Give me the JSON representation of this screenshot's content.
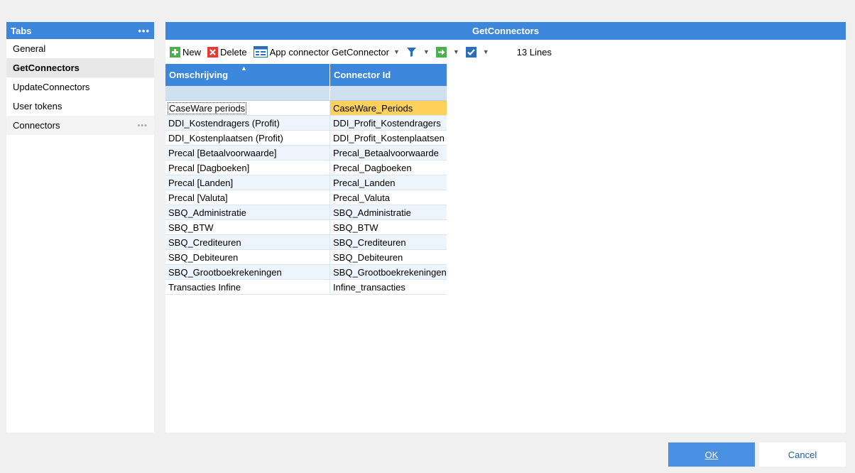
{
  "sidebar": {
    "title": "Tabs",
    "menu_dots": "•••",
    "items": [
      {
        "label": "General"
      },
      {
        "label": "GetConnectors"
      },
      {
        "label": "UpdateConnectors"
      },
      {
        "label": "User tokens"
      },
      {
        "label": "Connectors",
        "dots": "•••"
      }
    ]
  },
  "main": {
    "title": "GetConnectors",
    "toolbar": {
      "new_label": "New",
      "delete_label": "Delete",
      "app_connector_label": "App connector GetConnector",
      "lines_count": "13 Lines"
    },
    "grid": {
      "columns": [
        "Omschrijving",
        "Connector Id"
      ],
      "rows": [
        [
          "CaseWare periods",
          "CaseWare_Periods"
        ],
        [
          "DDI_Kostendragers (Profit)",
          "DDI_Profit_Kostendragers"
        ],
        [
          "DDI_Kostenplaatsen (Profit)",
          "DDI_Profit_Kostenplaatsen"
        ],
        [
          "Precal [Betaalvoorwaarde]",
          "Precal_Betaalvoorwaarde"
        ],
        [
          "Precal [Dagboeken]",
          "Precal_Dagboeken"
        ],
        [
          "Precal [Landen]",
          "Precal_Landen"
        ],
        [
          "Precal [Valuta]",
          "Precal_Valuta"
        ],
        [
          "SBQ_Administratie",
          "SBQ_Administratie"
        ],
        [
          "SBQ_BTW",
          "SBQ_BTW"
        ],
        [
          "SBQ_Crediteuren",
          "SBQ_Crediteuren"
        ],
        [
          "SBQ_Debiteuren",
          "SBQ_Debiteuren"
        ],
        [
          "SBQ_Grootboekrekeningen",
          "SBQ_Grootboekrekeningen"
        ],
        [
          "Transacties Infine",
          "Infine_transacties"
        ]
      ]
    }
  },
  "footer": {
    "ok_label": "OK",
    "cancel_label": "Cancel"
  },
  "colors": {
    "accent": "#3c87dc",
    "selected_row": "#ffd15c",
    "ok_button": "#4a90e2"
  }
}
